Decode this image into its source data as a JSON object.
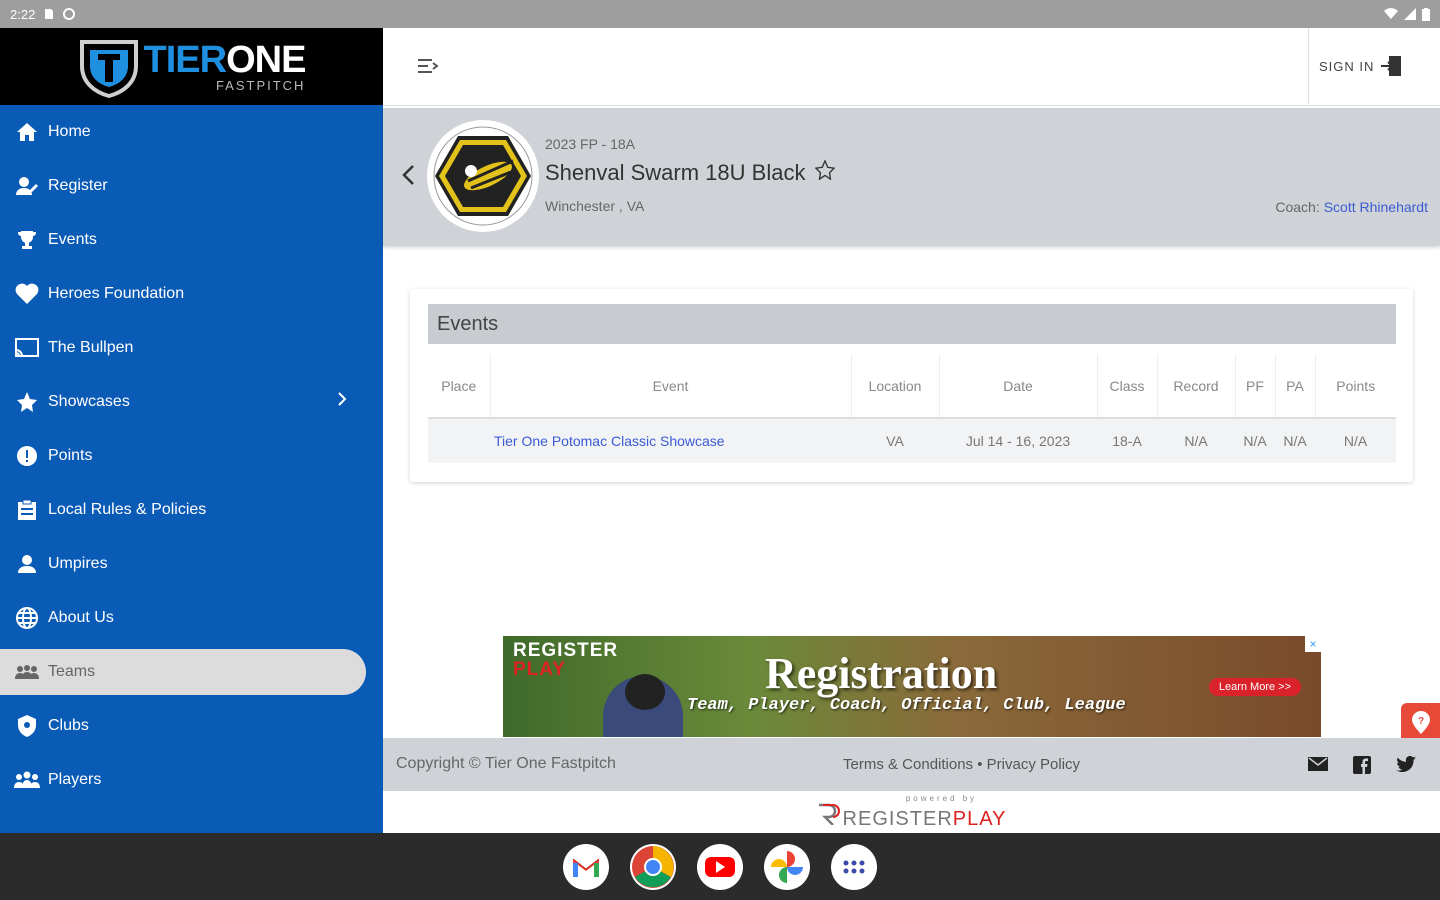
{
  "status_bar": {
    "time": "2:22"
  },
  "brand": {
    "name_part1": "TIER",
    "name_part2": "ONE",
    "sub": "FASTPITCH"
  },
  "sidebar": {
    "items": [
      {
        "label": "Home",
        "icon": "home-icon"
      },
      {
        "label": "Register",
        "icon": "register-icon"
      },
      {
        "label": "Events",
        "icon": "trophy-icon"
      },
      {
        "label": "Heroes Foundation",
        "icon": "heart-icon"
      },
      {
        "label": "The Bullpen",
        "icon": "cast-icon"
      },
      {
        "label": "Showcases",
        "icon": "star-icon"
      },
      {
        "label": "Points",
        "icon": "points-icon"
      },
      {
        "label": "Local Rules & Policies",
        "icon": "clipboard-icon"
      },
      {
        "label": "Umpires",
        "icon": "person-icon"
      },
      {
        "label": "About Us",
        "icon": "globe-icon"
      },
      {
        "label": "Teams",
        "icon": "teams-icon",
        "active": true
      },
      {
        "label": "Clubs",
        "icon": "shield-icon"
      },
      {
        "label": "Players",
        "icon": "players-icon"
      }
    ]
  },
  "header": {
    "signin_label": "SIGN IN"
  },
  "team": {
    "season": "2023 FP - 18A",
    "name": "Shenval Swarm 18U Black",
    "location": "Winchester , VA",
    "coach_label": "Coach:",
    "coach_name": "Scott Rhinehardt"
  },
  "events": {
    "title": "Events",
    "columns": [
      "Place",
      "Event",
      "Location",
      "Date",
      "Class",
      "Record",
      "PF",
      "PA",
      "Points"
    ],
    "rows": [
      {
        "place": "",
        "event": "Tier One Potomac Classic Showcase",
        "location": "VA",
        "date": "Jul 14 - 16, 2023",
        "class": "18-A",
        "record": "N/A",
        "pf": "N/A",
        "pa": "N/A",
        "points": "N/A"
      }
    ]
  },
  "ad": {
    "brand_register": "REGISTER",
    "brand_play": "PLAY",
    "headline": "Registration",
    "tagline": "Team, Player, Coach, Official, Club, League",
    "cta": "Learn More >>",
    "close": "×"
  },
  "footer": {
    "copyright": "Copyright © Tier One Fastpitch",
    "terms": "Terms & Conditions",
    "separator": "•",
    "privacy": "Privacy Policy",
    "powered_by": "powered by",
    "powered_brand_1": "REGISTER",
    "powered_brand_2": "PLAY"
  },
  "colors": {
    "sidebar": "#0a5bb5",
    "accent_link": "#3b5bd6",
    "team_bar": "#cfd3d7",
    "help_button": "#e84a3a"
  }
}
